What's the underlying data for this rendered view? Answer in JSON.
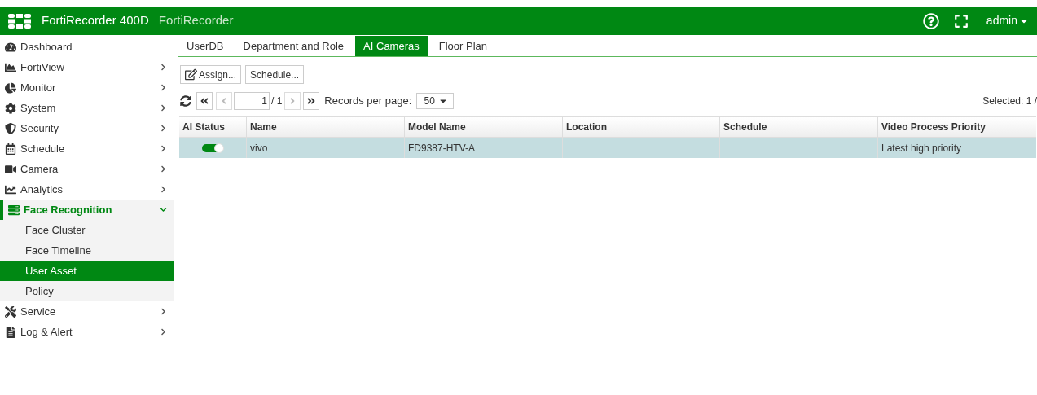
{
  "header": {
    "product": "FortiRecorder 400D",
    "hostname": "FortiRecorder",
    "user": "admin"
  },
  "sidebar": {
    "items": [
      {
        "label": "Dashboard",
        "expandable": false,
        "expanded": false
      },
      {
        "label": "FortiView",
        "expandable": true,
        "expanded": false
      },
      {
        "label": "Monitor",
        "expandable": true,
        "expanded": false
      },
      {
        "label": "System",
        "expandable": true,
        "expanded": false
      },
      {
        "label": "Security",
        "expandable": true,
        "expanded": false
      },
      {
        "label": "Schedule",
        "expandable": true,
        "expanded": false
      },
      {
        "label": "Camera",
        "expandable": true,
        "expanded": false
      },
      {
        "label": "Analytics",
        "expandable": true,
        "expanded": false
      },
      {
        "label": "Face Recognition",
        "expandable": true,
        "expanded": true,
        "children": [
          {
            "label": "Face Cluster",
            "selected": false
          },
          {
            "label": "Face Timeline",
            "selected": false
          },
          {
            "label": "User Asset",
            "selected": true
          },
          {
            "label": "Policy",
            "selected": false
          }
        ]
      },
      {
        "label": "Service",
        "expandable": true,
        "expanded": false
      },
      {
        "label": "Log & Alert",
        "expandable": true,
        "expanded": false
      }
    ]
  },
  "tabs": [
    {
      "label": "UserDB",
      "selected": false
    },
    {
      "label": "Department and Role",
      "selected": false
    },
    {
      "label": "AI Cameras",
      "selected": true
    },
    {
      "label": "Floor Plan",
      "selected": false
    }
  ],
  "toolbar": {
    "buttons": [
      "Assign...",
      "Schedule..."
    ]
  },
  "pager": {
    "page": "1",
    "total": "/ 1",
    "records_label": "Records per page:",
    "records_value": "50",
    "selected": "Selected: 1 /"
  },
  "table": {
    "columns": [
      "AI Status",
      "Name",
      "Model Name",
      "Location",
      "Schedule",
      "Video Process Priority"
    ],
    "rows": [
      {
        "selected": true,
        "ai_status_on": true,
        "cells": [
          "",
          "vivo",
          "FD9387-HTV-A",
          "",
          "",
          "Latest high priority"
        ]
      }
    ]
  }
}
